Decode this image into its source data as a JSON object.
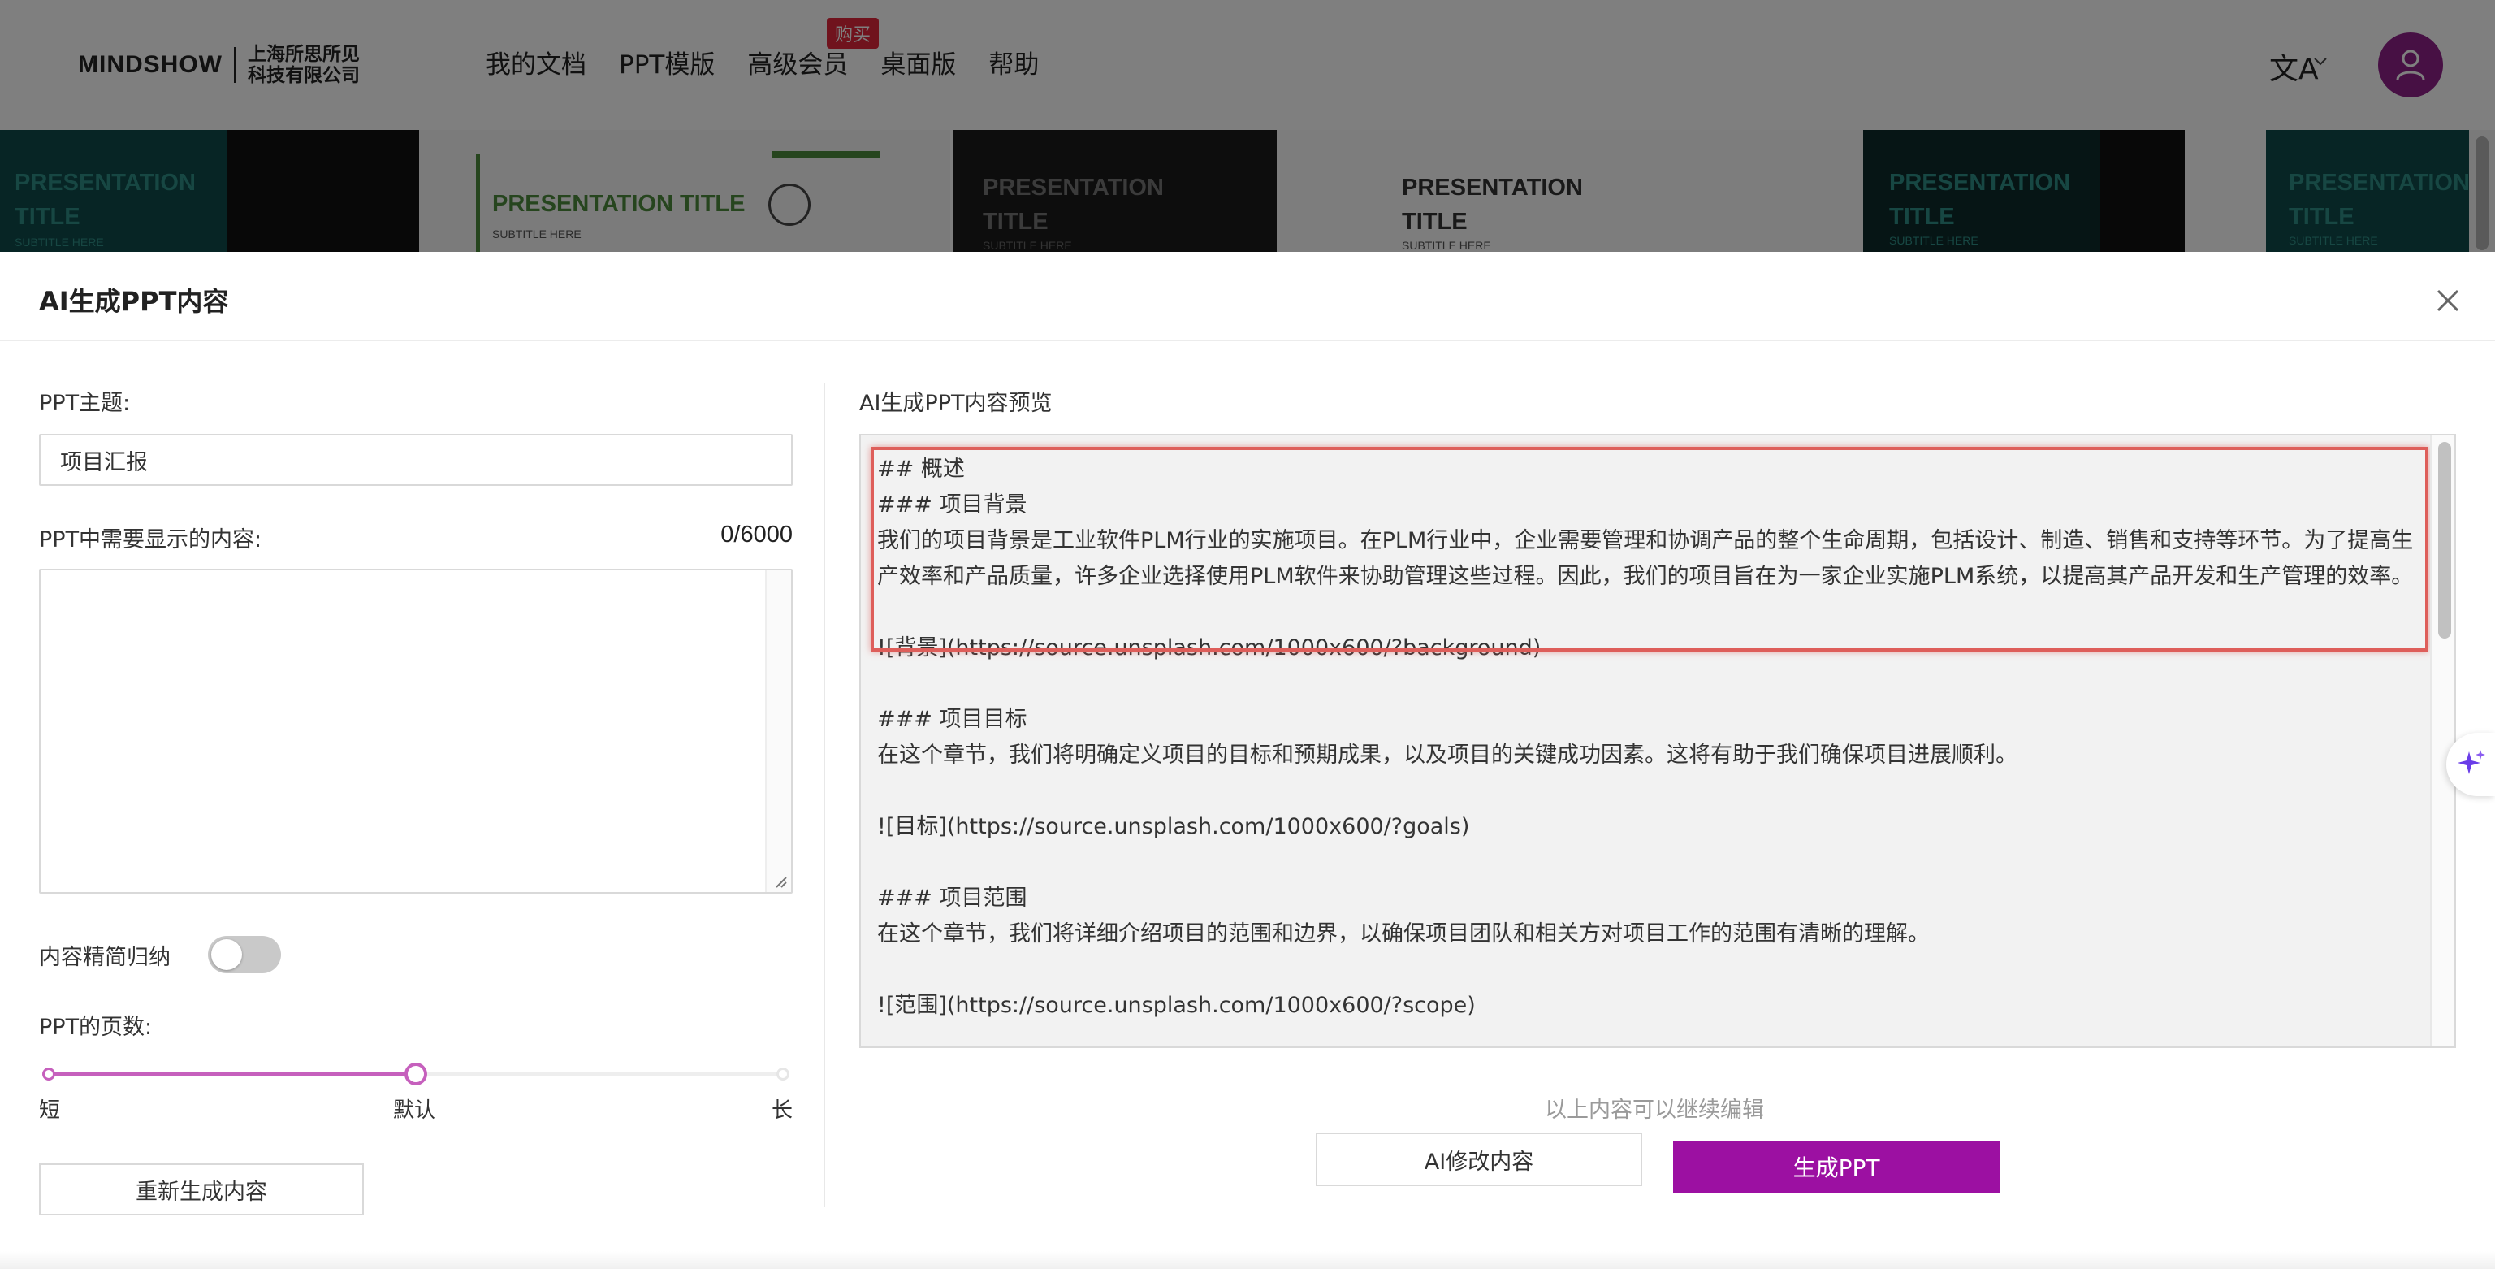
{
  "brand": {
    "logo_text": "MINDSHOW",
    "company_line1": "上海所思所见",
    "company_line2": "科技有限公司"
  },
  "nav": {
    "items": [
      "我的文档",
      "PPT模版",
      "高级会员",
      "桌面版",
      "帮助"
    ],
    "badge": "购买",
    "lang_icon": "文A"
  },
  "templates": [
    {
      "title": "PRESENTATION TITLE",
      "subtitle": "SUBTITLE HERE"
    },
    {
      "title": "PRESENTATION TITLE",
      "subtitle": "SUBTITLE HERE"
    },
    {
      "title": "PRESENTATION TITLE",
      "subtitle": "SUBTITLE HERE"
    },
    {
      "title": "PRESENTATION TITLE",
      "subtitle": "SUBTITLE HERE"
    },
    {
      "title": "PRESENTATION TITLE",
      "subtitle": "SUBTITLE HERE"
    },
    {
      "title": "PRESENTATION TITLE",
      "subtitle": "SUBTITLE HERE"
    }
  ],
  "modal": {
    "title": "AI生成PPT内容",
    "topic_label": "PPT主题:",
    "topic_value": "项目汇报",
    "content_label": "PPT中需要显示的内容:",
    "counter": "0/6000",
    "content_value": "",
    "simplify_label": "内容精简归纳",
    "simplify_on": false,
    "pages_label": "PPT的页数:",
    "pages_marks": [
      "短",
      "默认",
      "长"
    ],
    "pages_level": 0.5,
    "regen_button": "重新生成内容",
    "preview_label": "AI生成PPT内容预览",
    "preview_lines": [
      "## 概述",
      "### 项目背景",
      "我们的项目背景是工业软件PLM行业的实施项目。在PLM行业中，企业需要管理和协调产品的整个生命周期，包括设计、制造、销售和支持等环节。为了提高生产效率和产品质量，许多企业选择使用PLM软件来协助管理这些过程。因此，我们的项目旨在为一家企业实施PLM系统，以提高其产品开发和生产管理的效率。",
      "",
      "![背景](https://source.unsplash.com/1000x600/?background)",
      "",
      "### 项目目标",
      "在这个章节，我们将明确定义项目的目标和预期成果，以及项目的关键成功因素。这将有助于我们确保项目进展顺利。",
      "",
      "![目标](https://source.unsplash.com/1000x600/?goals)",
      "",
      "### 项目范围",
      "在这个章节，我们将详细介绍项目的范围和边界，以确保项目团队和相关方对项目工作的范围有清晰的理解。",
      "",
      "![范围](https://source.unsplash.com/1000x600/?scope)"
    ],
    "hint": "以上内容可以继续编辑",
    "ai_edit_button": "AI修改内容",
    "generate_button": "生成PPT"
  },
  "colors": {
    "accent": "#9c10a2",
    "slider": "#c660bd",
    "highlight": "#de5e5a",
    "badge": "#e0263a"
  },
  "icons": {
    "close": "close-icon",
    "avatar": "user-icon",
    "sparkle": "sparkle-icon",
    "language": "translate-icon"
  }
}
